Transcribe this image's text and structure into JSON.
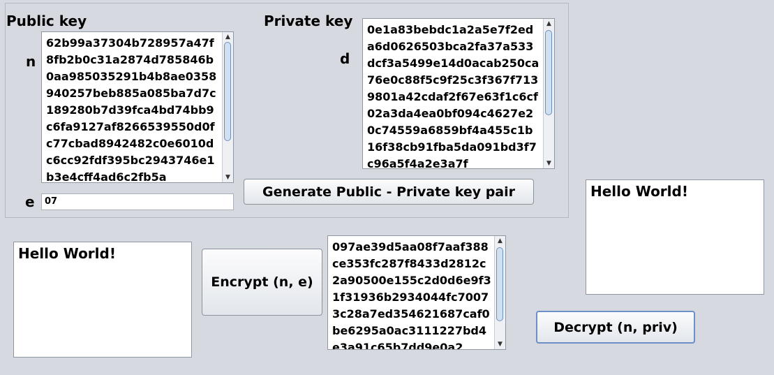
{
  "public_key": {
    "title": "Public key",
    "n_label": "n",
    "n_value": "62b99a37304b728957a47f8fb2b0c31a2874d785846b0aa985035291b4b8ae0358940257beb885a085ba7d7c189280b7d39fca4bd74bb9c6fa9127af8266539550d0fc77cbad8942482c0e6010dc6cc92fdf395bc2943746e1b3e4cff4ad6c2fb5a",
    "e_label": "e",
    "e_value": "07"
  },
  "private_key": {
    "title": "Private key",
    "d_label": "d",
    "d_value": "0e1a83bebdc1a2a5e7f2eda6d0626503bca2fa37a533dcf3a5499e14d0acab250ca76e0c88f5c9f25c3f367f7139801a42cdaf2f67e63f1c6cf02a3da4ea0bf094c4627e20c74559a6859bf4a455c1b16f38cb91fba5da091bd3f7c96a5f4a2e3a7f"
  },
  "buttons": {
    "generate": "Generate Public - Private key pair",
    "encrypt": "Encrypt (n, e)",
    "decrypt": "Decrypt (n, priv)"
  },
  "plaintext_input": "Hello World!",
  "ciphertext": "097ae39d5aa08f7aaf388ce353fc287f8433d2812c2a90500e155c2d0d6e9f31f31936b2934044fc70073c28a7ed354621687caf0be6295a0ac3111227bd4e3a91c65b7dd9e0a2",
  "decrypted_output": "Hello World!",
  "icons": {
    "scroll_up": "▲",
    "scroll_down": "▼"
  }
}
